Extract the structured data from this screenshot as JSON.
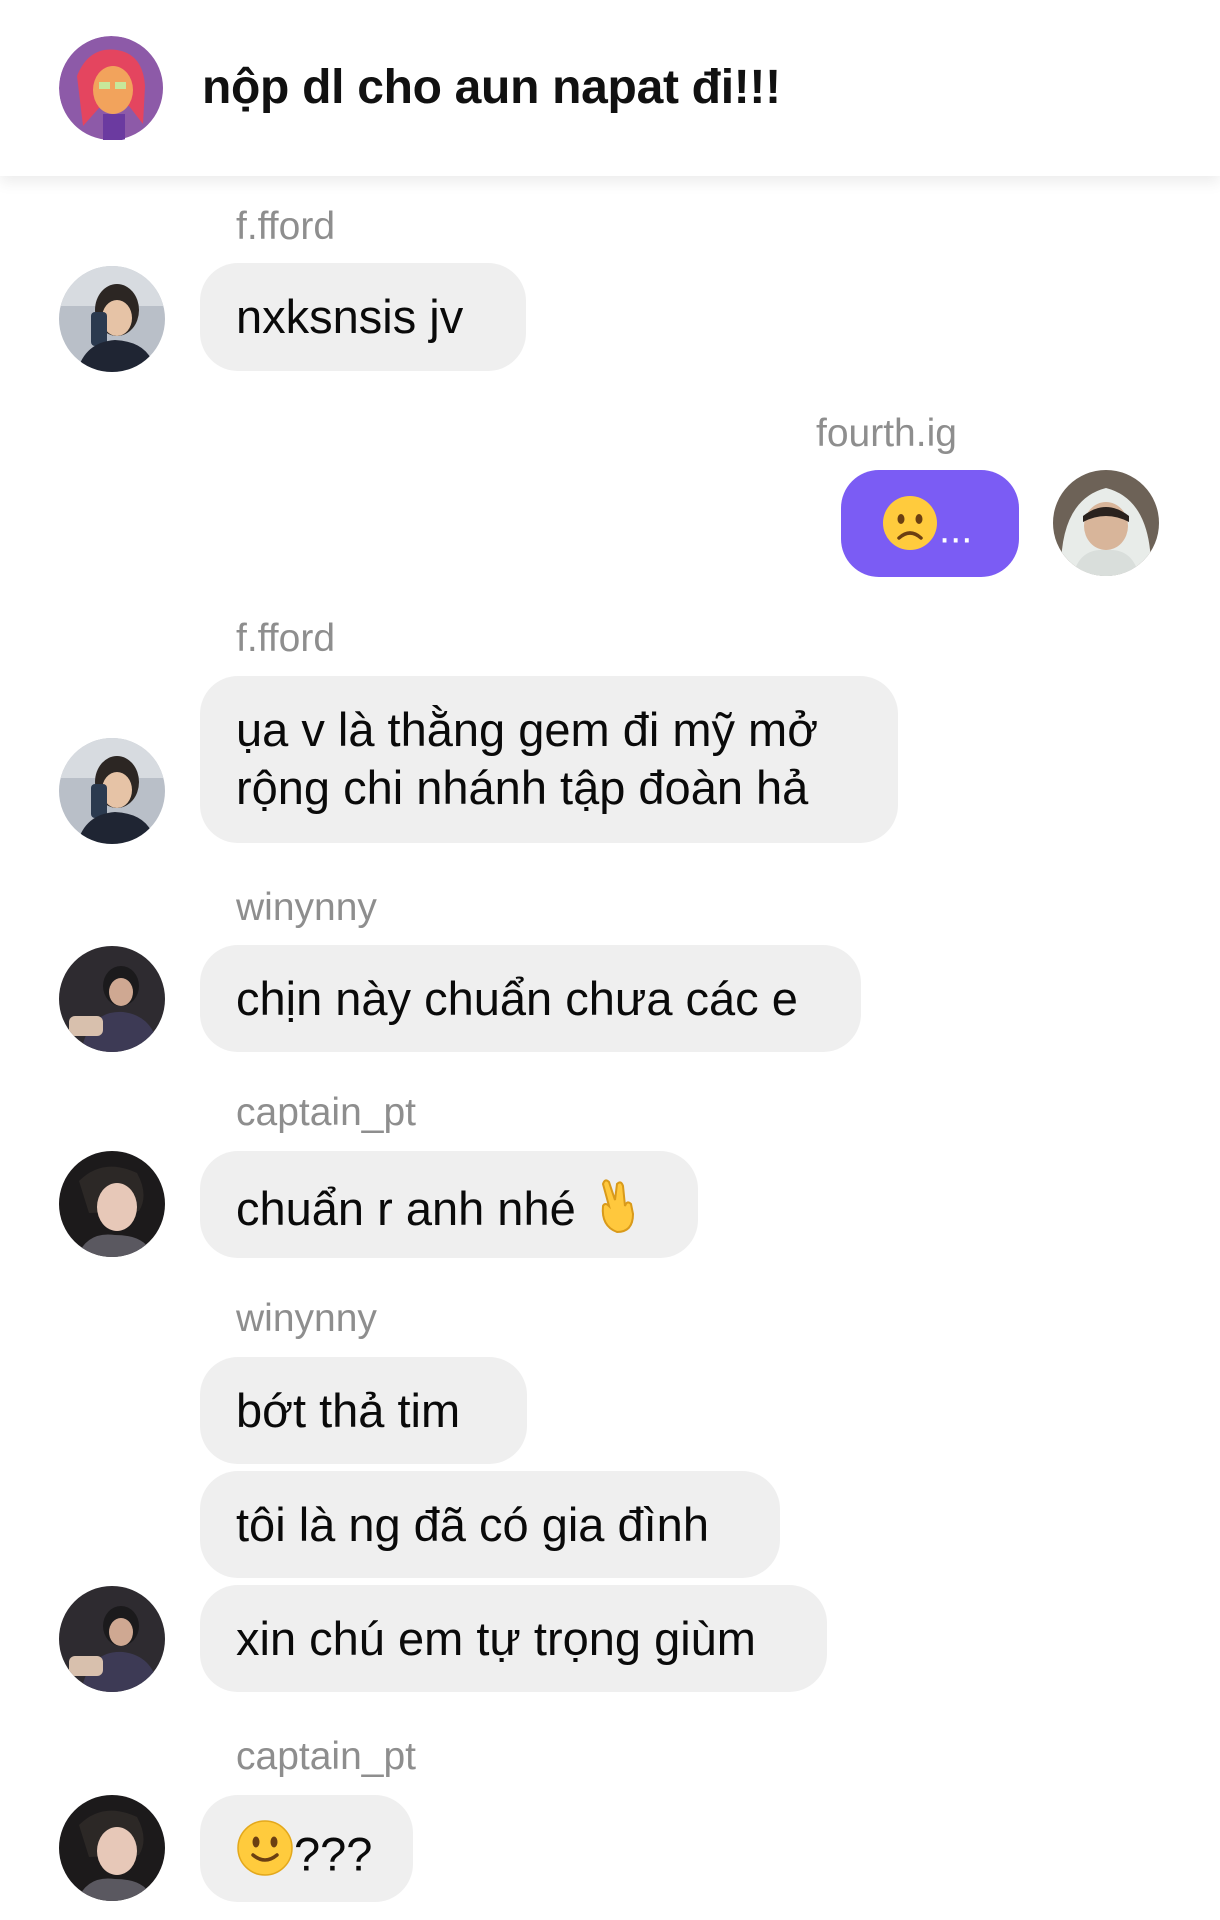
{
  "header": {
    "title": "nộp dl cho aun napat đi!!!"
  },
  "messages": [
    {
      "sender": "f.fford",
      "lines": [
        "nxksnsis jv"
      ]
    },
    {
      "sender": "fourth.ig",
      "text": "...",
      "emoji": "worried-face-emoji"
    },
    {
      "sender": "f.fford",
      "lines": [
        "ụa v là thằng gem đi mỹ mở",
        "rộng chi nhánh tập đoàn hả"
      ]
    },
    {
      "sender": "winynny",
      "lines": [
        "chịn này chuẩn chưa các e"
      ]
    },
    {
      "sender": "captain_pt",
      "lines": [
        "chuẩn r anh nhé"
      ],
      "emoji": "fingers-crossed-emoji"
    },
    {
      "sender": "winynny",
      "lines": [
        "bớt thả tim",
        "tôi là ng đã có gia đình",
        "xin chú em tự trọng giùm"
      ]
    },
    {
      "sender": "captain_pt",
      "text": "???",
      "emoji": "slightly-smiling-face-emoji"
    }
  ],
  "colors": {
    "outgoing_bubble": "#7b5cf4",
    "incoming_bubble": "#efefef",
    "sender_text": "#8e8e8e"
  }
}
